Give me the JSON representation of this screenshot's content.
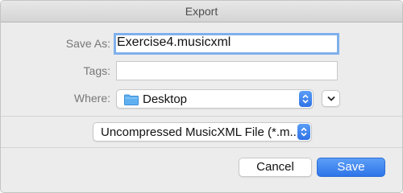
{
  "window": {
    "title": "Export"
  },
  "form": {
    "save_as_label": "Save As:",
    "save_as_value": "Exercise4.musicxml",
    "tags_label": "Tags:",
    "tags_value": "",
    "where_label": "Where:",
    "where_value": "Desktop"
  },
  "format": {
    "selected": "Uncompressed MusicXML File (*.m..."
  },
  "buttons": {
    "cancel": "Cancel",
    "save": "Save"
  },
  "colors": {
    "accent": "#2f72e6",
    "focus_ring": "#7fb0ec",
    "folder": "#5fb0f0"
  },
  "icons": {
    "where_folder": "folder-icon",
    "where_stepper": "up-down-chevron-icon",
    "expand": "chevron-down-icon",
    "format_stepper": "up-down-chevron-icon"
  }
}
